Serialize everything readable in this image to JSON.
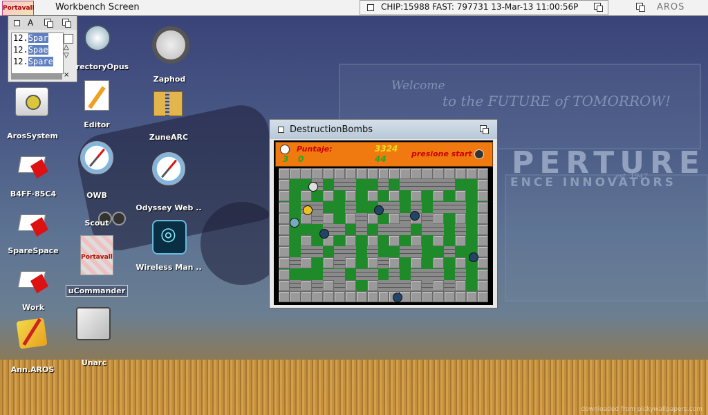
{
  "screen": {
    "title": "Workbench Screen",
    "memory_status": "CHIP:15988 FAST: 797731 13-Mar-13 11:00:56P",
    "os_logo": "AROS",
    "logo_text": "Portavall"
  },
  "clock_window": {
    "gadget_label": "A",
    "lines": [
      {
        "num": "12.",
        "text": "Spar"
      },
      {
        "num": "12.",
        "text": "Spae"
      },
      {
        "num": "12.",
        "text": "Spare"
      }
    ],
    "close_glyph": "×"
  },
  "desktop_icons": [
    {
      "id": "directoryopus",
      "label": "rectoryOpus",
      "icon": "directory-opus-icon"
    },
    {
      "id": "zaphod",
      "label": "Zaphod",
      "icon": "magnifier-file-icon"
    },
    {
      "id": "arossystem",
      "label": "ArosSystem",
      "icon": "system-disk-icon"
    },
    {
      "id": "editor",
      "label": "Editor",
      "icon": "editor-pencil-icon"
    },
    {
      "id": "zunearc",
      "label": "ZuneARC",
      "icon": "archive-icon"
    },
    {
      "id": "b4ff",
      "label": "B4FF-85C4",
      "icon": "drive-icon"
    },
    {
      "id": "owb",
      "label": "OWB",
      "icon": "compass-icon"
    },
    {
      "id": "odyssey",
      "label": "Odyssey Web ..",
      "icon": "compass-icon"
    },
    {
      "id": "scout",
      "label": "Scout",
      "icon": "binoculars-icon"
    },
    {
      "id": "sparespace",
      "label": "SpareSpace",
      "icon": "drive-icon"
    },
    {
      "id": "wireless",
      "label": "Wireless Man ..",
      "icon": "wireless-icon"
    },
    {
      "id": "ucommander",
      "label": "uCommander",
      "icon": "portavall-icon"
    },
    {
      "id": "work",
      "label": "Work",
      "icon": "drive-icon"
    },
    {
      "id": "annaros",
      "label": "Ann.AROS",
      "icon": "notepad-icon"
    },
    {
      "id": "unarc",
      "label": "Unarc",
      "icon": "box-icon"
    }
  ],
  "game_window": {
    "title": "DestructionBombs",
    "hud": {
      "score_label": "Puntaje:",
      "lives": "3",
      "score": "0",
      "timer_top": "3324",
      "timer_bottom": "44",
      "prompt": "presione start"
    }
  },
  "wallpaper": {
    "welcome": "Welcome",
    "slogan": "to the FUTURE of TOMORROW!",
    "brand": "PERTURE",
    "brand_sub": "ENCE INNOVATORS",
    "est": "est. 1947",
    "credit": "downloaded from pickywallpapers.com"
  },
  "colors": {
    "hud_orange": "#f07a10",
    "board_green": "#1f8a2a",
    "selection_blue": "#5f7fc1"
  }
}
